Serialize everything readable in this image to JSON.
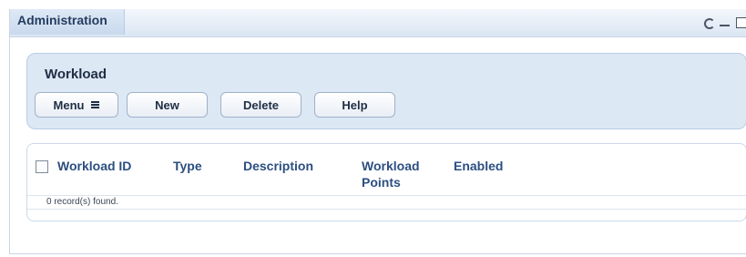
{
  "portlet": {
    "title": "Administration",
    "controls": [
      "refresh-icon",
      "minimize-icon",
      "maximize-icon"
    ]
  },
  "toolbar": {
    "title": "Workload",
    "menu_label": "Menu",
    "new_label": "New",
    "delete_label": "Delete",
    "help_label": "Help"
  },
  "table": {
    "columns": [
      "Workload ID",
      "Type",
      "Description",
      "Workload Points",
      "Enabled"
    ],
    "rows": [],
    "status": "0 record(s) found."
  },
  "colors": {
    "header_gradient": "#dbe6f3",
    "panel_background": "#dde8f5",
    "column_text": "#2c4f80"
  }
}
